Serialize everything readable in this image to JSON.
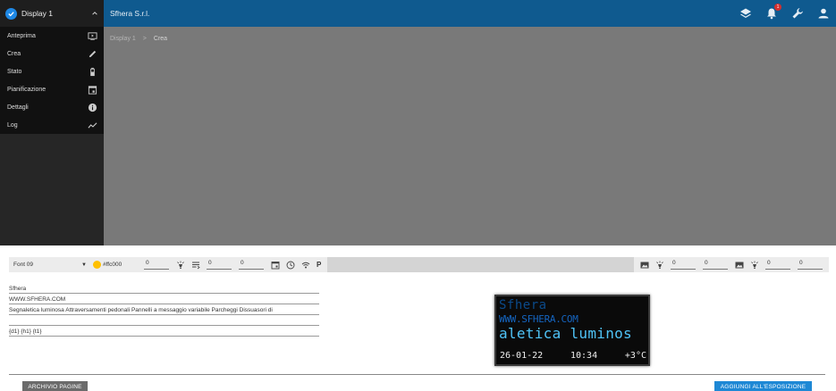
{
  "sidebar": {
    "title": "Display 1",
    "items": [
      {
        "label": "Anteprima",
        "icon": "preview-icon"
      },
      {
        "label": "Crea",
        "icon": "pencil-icon"
      },
      {
        "label": "Stato",
        "icon": "battery-icon"
      },
      {
        "label": "Pianificazione",
        "icon": "calendar-icon"
      },
      {
        "label": "Dettagli",
        "icon": "info-icon"
      },
      {
        "label": "Log",
        "icon": "chart-line-icon"
      }
    ]
  },
  "topbar": {
    "company": "Sfhera S.r.l.",
    "notification_count": "1"
  },
  "breadcrumb": {
    "root": "Display 1",
    "separator": ">",
    "current": "Crea"
  },
  "toolbar": {
    "font": "Font 09",
    "color_hex": "#ffc000",
    "color_value": "#ffc000",
    "inputs": [
      "0",
      "0",
      "0",
      "0",
      "0",
      "0",
      "0"
    ]
  },
  "lines": [
    "Sfhera",
    "WWW.SFHERA.COM",
    "Segnaletica luminosa   Attraversamenti pedonali   Pannelli a messaggio variabile   Parcheggi   Dissuasori di",
    "",
    "{d1}      {h1}      {t1}"
  ],
  "preview": {
    "line1": "Sfhera",
    "line2": "WWW.SFHERA.COM",
    "line3": "aletica luminos",
    "date": "26-01-22",
    "time": "10:34",
    "temp": "+3°C"
  },
  "buttons": {
    "archive": "ARCHIVIO PAGINE",
    "add": "AGGIUNGI ALL'ESPOSIZIONE"
  }
}
